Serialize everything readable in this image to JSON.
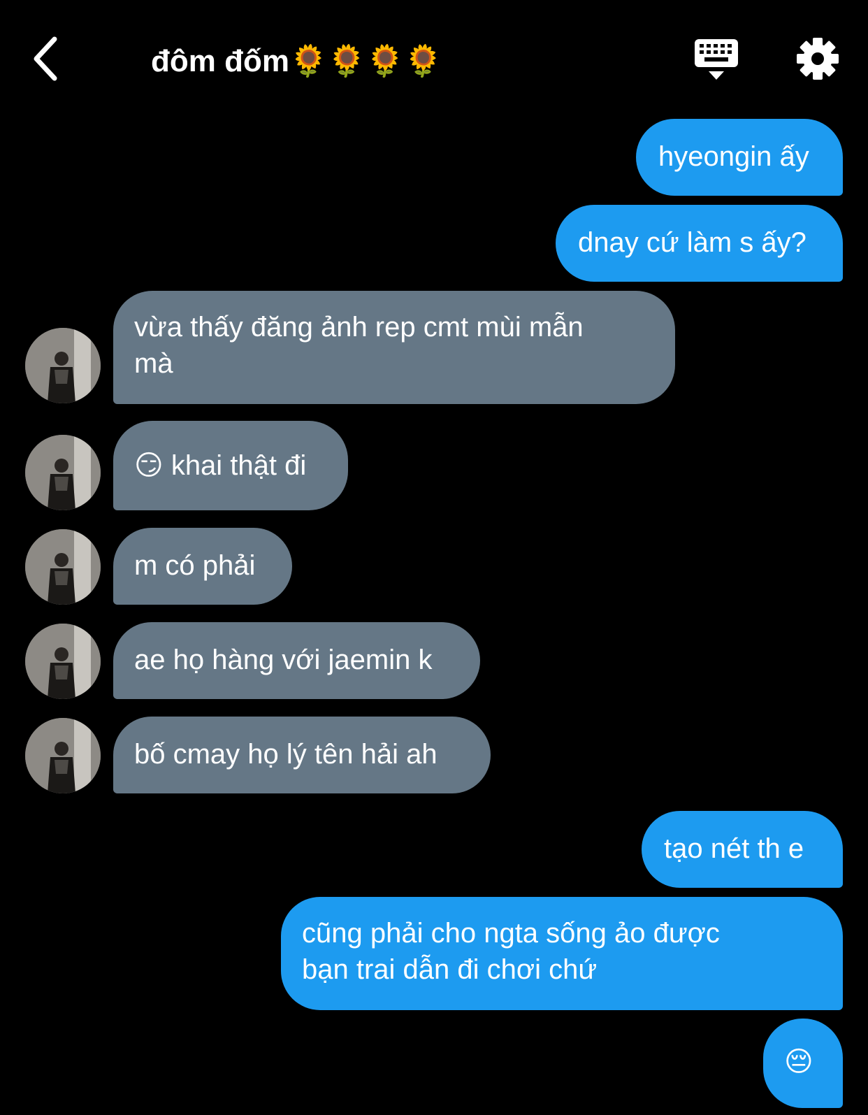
{
  "header": {
    "back_icon": "chevron-left-icon",
    "title": "đôm đốm🌻🌻🌻🌻",
    "keyboard_icon": "keyboard-icon",
    "settings_icon": "gear-icon"
  },
  "messages": [
    {
      "direction": "sent",
      "text": "hyeongin ấy"
    },
    {
      "direction": "sent",
      "text": "dnay cứ làm s ấy?"
    },
    {
      "direction": "received",
      "text": "vừa thấy đăng ảnh rep cmt mùi mẫn\nmà"
    },
    {
      "direction": "received",
      "text": "😏 khai thật đi"
    },
    {
      "direction": "received",
      "text": "m có phải"
    },
    {
      "direction": "received",
      "text": "ae họ hàng với jaemin k"
    },
    {
      "direction": "received",
      "text": "bố cmay họ lý tên hải ah"
    },
    {
      "direction": "sent",
      "text": "tạo nét th e"
    },
    {
      "direction": "sent",
      "text": "cũng phải cho ngta sống ảo được\nbạn trai dẫn đi chơi chứ"
    },
    {
      "direction": "sent",
      "text": "😔"
    }
  ],
  "colors": {
    "background": "#000000",
    "sent_bubble": "#1d9bf0",
    "received_bubble": "#657786",
    "text": "#ffffff"
  }
}
